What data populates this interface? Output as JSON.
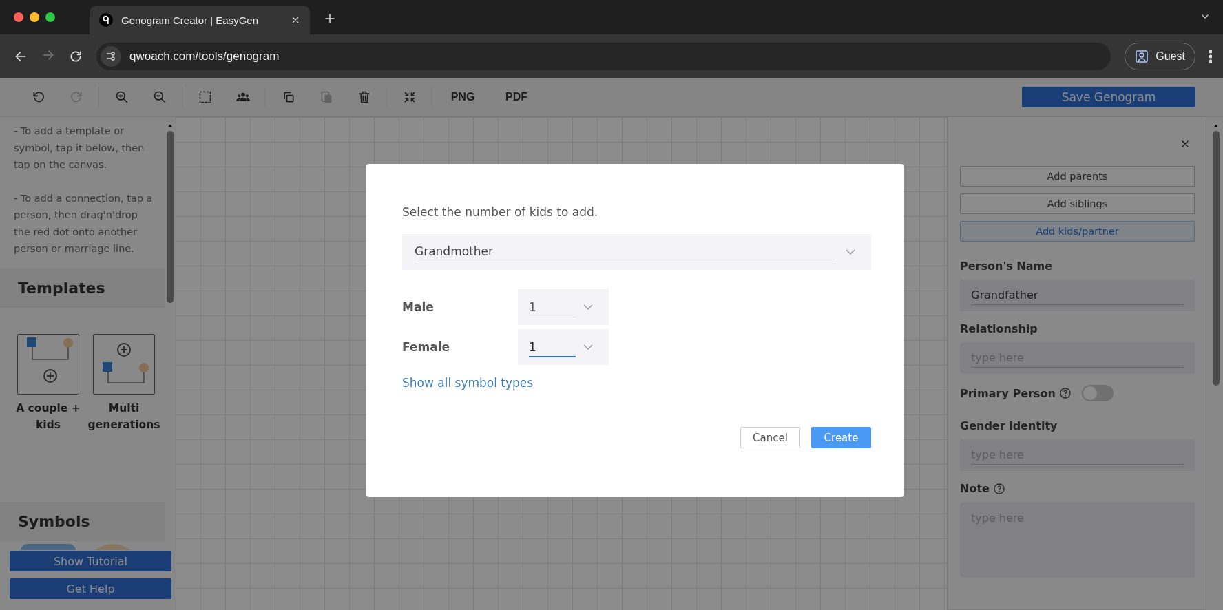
{
  "browser": {
    "tab_title": "Genogram Creator | EasyGen",
    "url": "qwoach.com/tools/genogram",
    "profile": "Guest"
  },
  "toolbar": {
    "items": [
      {
        "kind": "undo",
        "disabled": false
      },
      {
        "kind": "redo",
        "disabled": true
      },
      {
        "kind": "zoom_in",
        "disabled": false
      },
      {
        "kind": "zoom_out",
        "disabled": false
      },
      {
        "kind": "select",
        "disabled": false
      },
      {
        "kind": "group",
        "disabled": false
      },
      {
        "kind": "copy",
        "disabled": false
      },
      {
        "kind": "paste",
        "disabled": true
      },
      {
        "kind": "delete",
        "disabled": false
      },
      {
        "kind": "fit",
        "disabled": false
      },
      {
        "kind": "text",
        "label": "PNG",
        "disabled": false
      },
      {
        "kind": "text",
        "label": "PDF",
        "disabled": false
      }
    ],
    "save_button": "Save Genogram"
  },
  "left_panel": {
    "instructions": [
      "- To add a template or symbol, tap it below, then tap on the canvas.",
      "- To add a connection, tap a person, then drag'n'drop the red dot onto another person or marriage line."
    ],
    "templates_heading": "Templates",
    "templates": [
      {
        "kind": "couple",
        "label": "A couple + kids"
      },
      {
        "kind": "multi",
        "label": "Multi generations"
      }
    ],
    "symbols_heading": "Symbols",
    "buttons": [
      "Show Tutorial",
      "Get Help"
    ]
  },
  "right_panel": {
    "actions": [
      {
        "label": "Add parents",
        "selected": false
      },
      {
        "label": "Add siblings",
        "selected": false
      },
      {
        "label": "Add kids/partner",
        "selected": true
      }
    ],
    "fields": [
      {
        "kind": "input",
        "label": "Person's Name",
        "value": "Grandfather"
      },
      {
        "kind": "input",
        "label": "Relationship",
        "placeholder": "type here"
      },
      {
        "kind": "toggle",
        "label": "Primary Person",
        "help": true,
        "on": false
      },
      {
        "kind": "input",
        "label": "Gender identity",
        "placeholder": "type here"
      },
      {
        "kind": "textarea",
        "label": "Note",
        "help": true,
        "placeholder": "type here"
      }
    ]
  },
  "dialog": {
    "prompt": "Select the number of kids to add.",
    "partner": "Grandmother",
    "counts": [
      {
        "label": "Male",
        "value": "1",
        "focused": false
      },
      {
        "label": "Female",
        "value": "1",
        "focused": true
      }
    ],
    "link": "Show all symbol types",
    "buttons": [
      {
        "kind": "secondary",
        "label": "Cancel"
      },
      {
        "kind": "primary",
        "label": "Create"
      }
    ]
  }
}
